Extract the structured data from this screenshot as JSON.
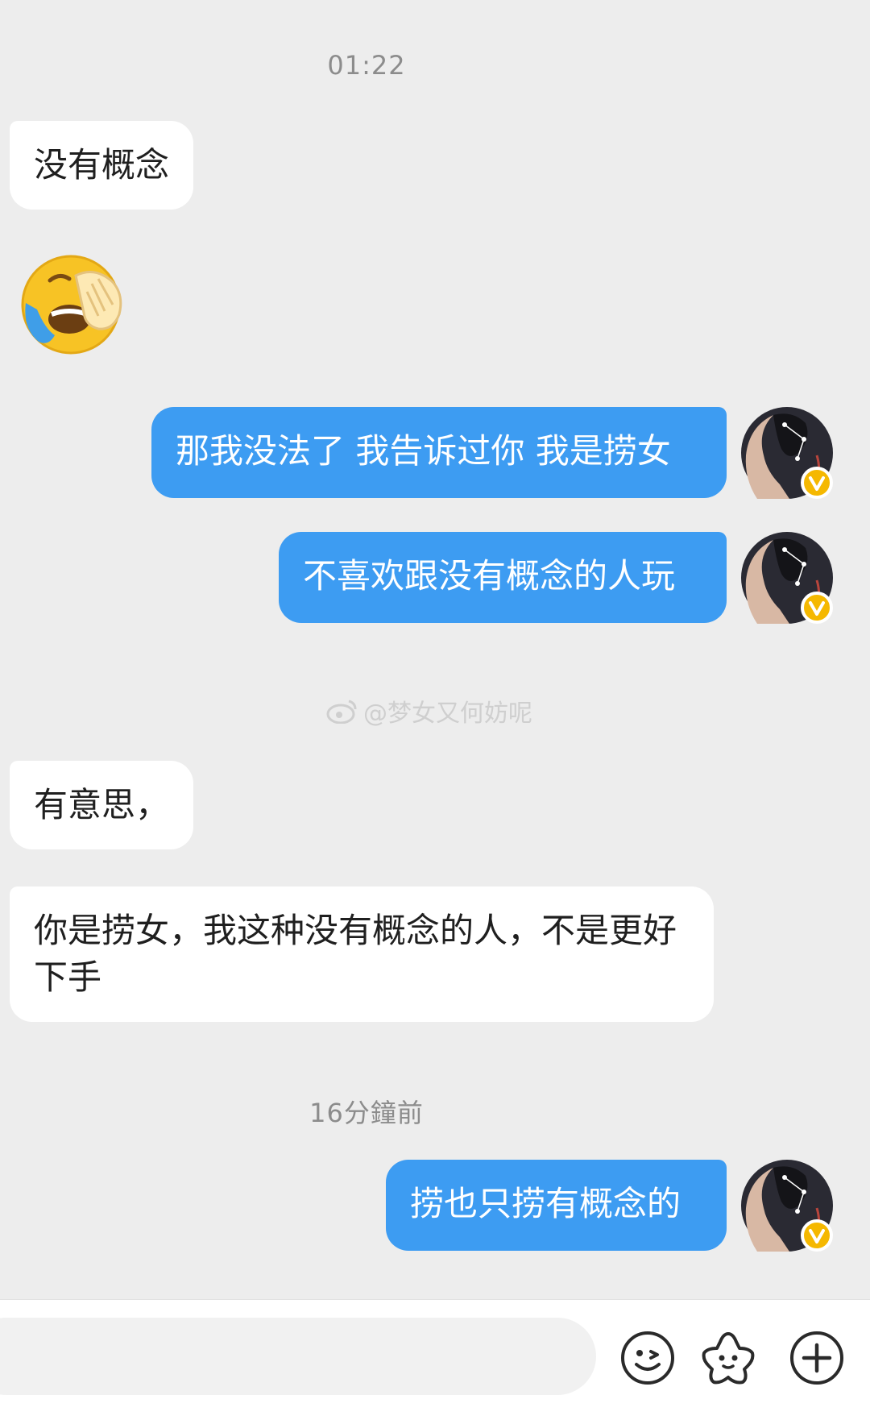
{
  "timestamps": {
    "first": "01:22",
    "second": "16分鐘前"
  },
  "messages": [
    {
      "side": "in",
      "text": "没有概念"
    },
    {
      "side": "in",
      "type": "emoji",
      "emoji": "facepalm-crying-emoji"
    },
    {
      "side": "out",
      "text": "那我没法了 我告诉过你 我是捞女"
    },
    {
      "side": "out",
      "text": "不喜欢跟没有概念的人玩"
    },
    {
      "side": "in",
      "text": "有意思，"
    },
    {
      "side": "in",
      "text": "你是捞女，我这种没有概念的人，不是更好下手"
    },
    {
      "side": "out",
      "text": "捞也只捞有概念的"
    }
  ],
  "watermark": {
    "text": "@梦女又何妨呢"
  },
  "input_bar": {
    "icons": [
      "emoji-icon",
      "sticker-icon",
      "plus-icon"
    ]
  },
  "colors": {
    "background": "#ededed",
    "outgoing_bubble": "#3d9cf2",
    "incoming_bubble": "#ffffff",
    "verified_badge": "#f5b800"
  }
}
